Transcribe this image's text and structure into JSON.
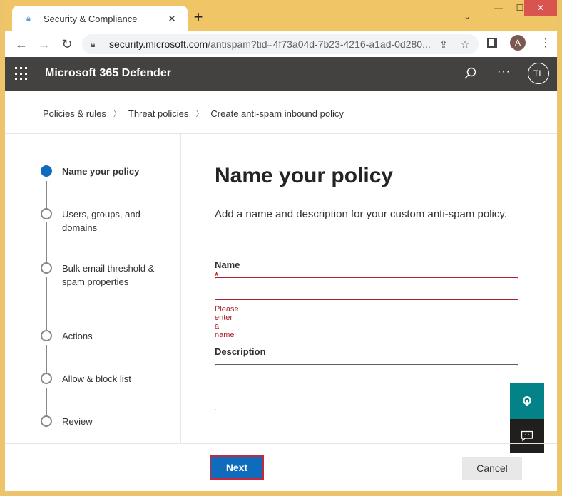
{
  "browser": {
    "tab_title": "Security & Compliance",
    "tab_icon": "lock-icon",
    "url_host": "security.microsoft.com",
    "url_path": "/antispam?tid=4f73a04d-7b23-4216-a1ad-0d280...",
    "profile_initial": "A",
    "new_tab_label": "+",
    "close_tab_label": "✕"
  },
  "app": {
    "title": "Microsoft 365 Defender",
    "avatar_initials": "TL",
    "more_label": "···"
  },
  "breadcrumb": {
    "items": [
      "Policies & rules",
      "Threat policies",
      "Create anti-spam inbound policy"
    ]
  },
  "wizard": {
    "steps": [
      {
        "label": "Name your policy",
        "state": "active"
      },
      {
        "label": "Users, groups, and domains",
        "state": "pending"
      },
      {
        "label": "Bulk email threshold & spam properties",
        "state": "pending"
      },
      {
        "label": "Actions",
        "state": "pending"
      },
      {
        "label": "Allow & block list",
        "state": "pending"
      },
      {
        "label": "Review",
        "state": "pending"
      }
    ]
  },
  "form": {
    "heading": "Name your policy",
    "description": "Add a name and description for your custom anti-spam policy.",
    "name_label": "Name",
    "required_marker": " *",
    "name_value": "",
    "name_error": "Please enter a name",
    "description_label": "Description",
    "description_value": ""
  },
  "footer": {
    "next_label": "Next",
    "cancel_label": "Cancel"
  },
  "colors": {
    "primary": "#0f6cbd",
    "error": "#a4262c",
    "appbar": "#434240",
    "help_fab": "#038387",
    "highlight_border": "#c5283d",
    "window_frame": "#edc46c"
  }
}
